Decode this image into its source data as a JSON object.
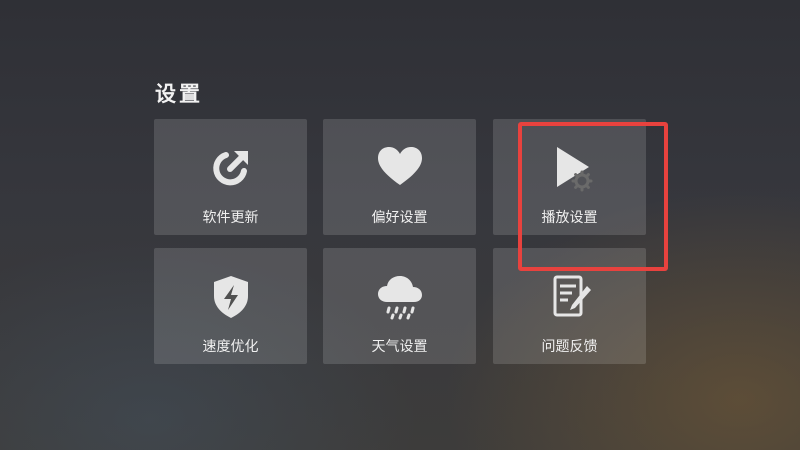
{
  "page": {
    "title": "设置"
  },
  "tiles": [
    {
      "label": "软件更新",
      "icon": "update-refresh-arrow-icon"
    },
    {
      "label": "偏好设置",
      "icon": "heart-icon"
    },
    {
      "label": "播放设置",
      "icon": "play-gear-icon"
    },
    {
      "label": "速度优化",
      "icon": "shield-lightning-icon"
    },
    {
      "label": "天气设置",
      "icon": "rain-cloud-icon"
    },
    {
      "label": "问题反馈",
      "icon": "document-pen-icon"
    }
  ],
  "annotation": {
    "highlight_color": "#e8423e",
    "highlighted_tile": "播放设置"
  }
}
